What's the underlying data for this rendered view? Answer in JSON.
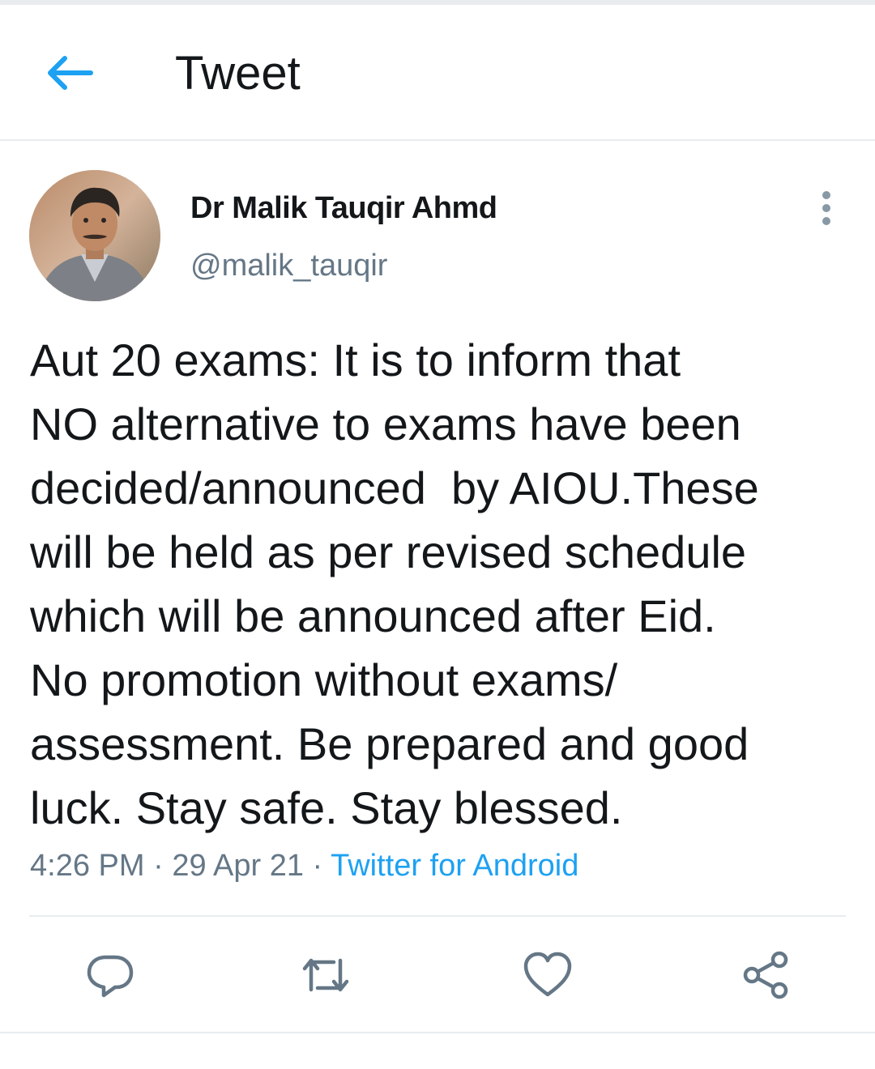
{
  "header": {
    "title": "Tweet",
    "back_icon": "arrow-left-icon"
  },
  "tweet": {
    "author": {
      "display_name": "Dr Malik Tauqir Ahmd",
      "handle": "@malik_tauqir"
    },
    "text": "Aut 20 exams: It is to inform that\nNO alternative to exams have been\ndecided/announced  by AIOU.These\nwill be held as per revised schedule\nwhich will be announced after Eid.\nNo promotion without exams/\nassessment. Be prepared and good\nluck. Stay safe. Stay blessed.",
    "time": "4:26 PM",
    "date": "29 Apr 21",
    "separator": " · ",
    "source": "Twitter for Android"
  },
  "actions": [
    "reply-icon",
    "retweet-icon",
    "like-icon",
    "share-icon"
  ],
  "colors": {
    "accent": "#1da1f2",
    "icon_gray": "#657786",
    "text": "#14171a",
    "divider": "#e6ecf0"
  }
}
